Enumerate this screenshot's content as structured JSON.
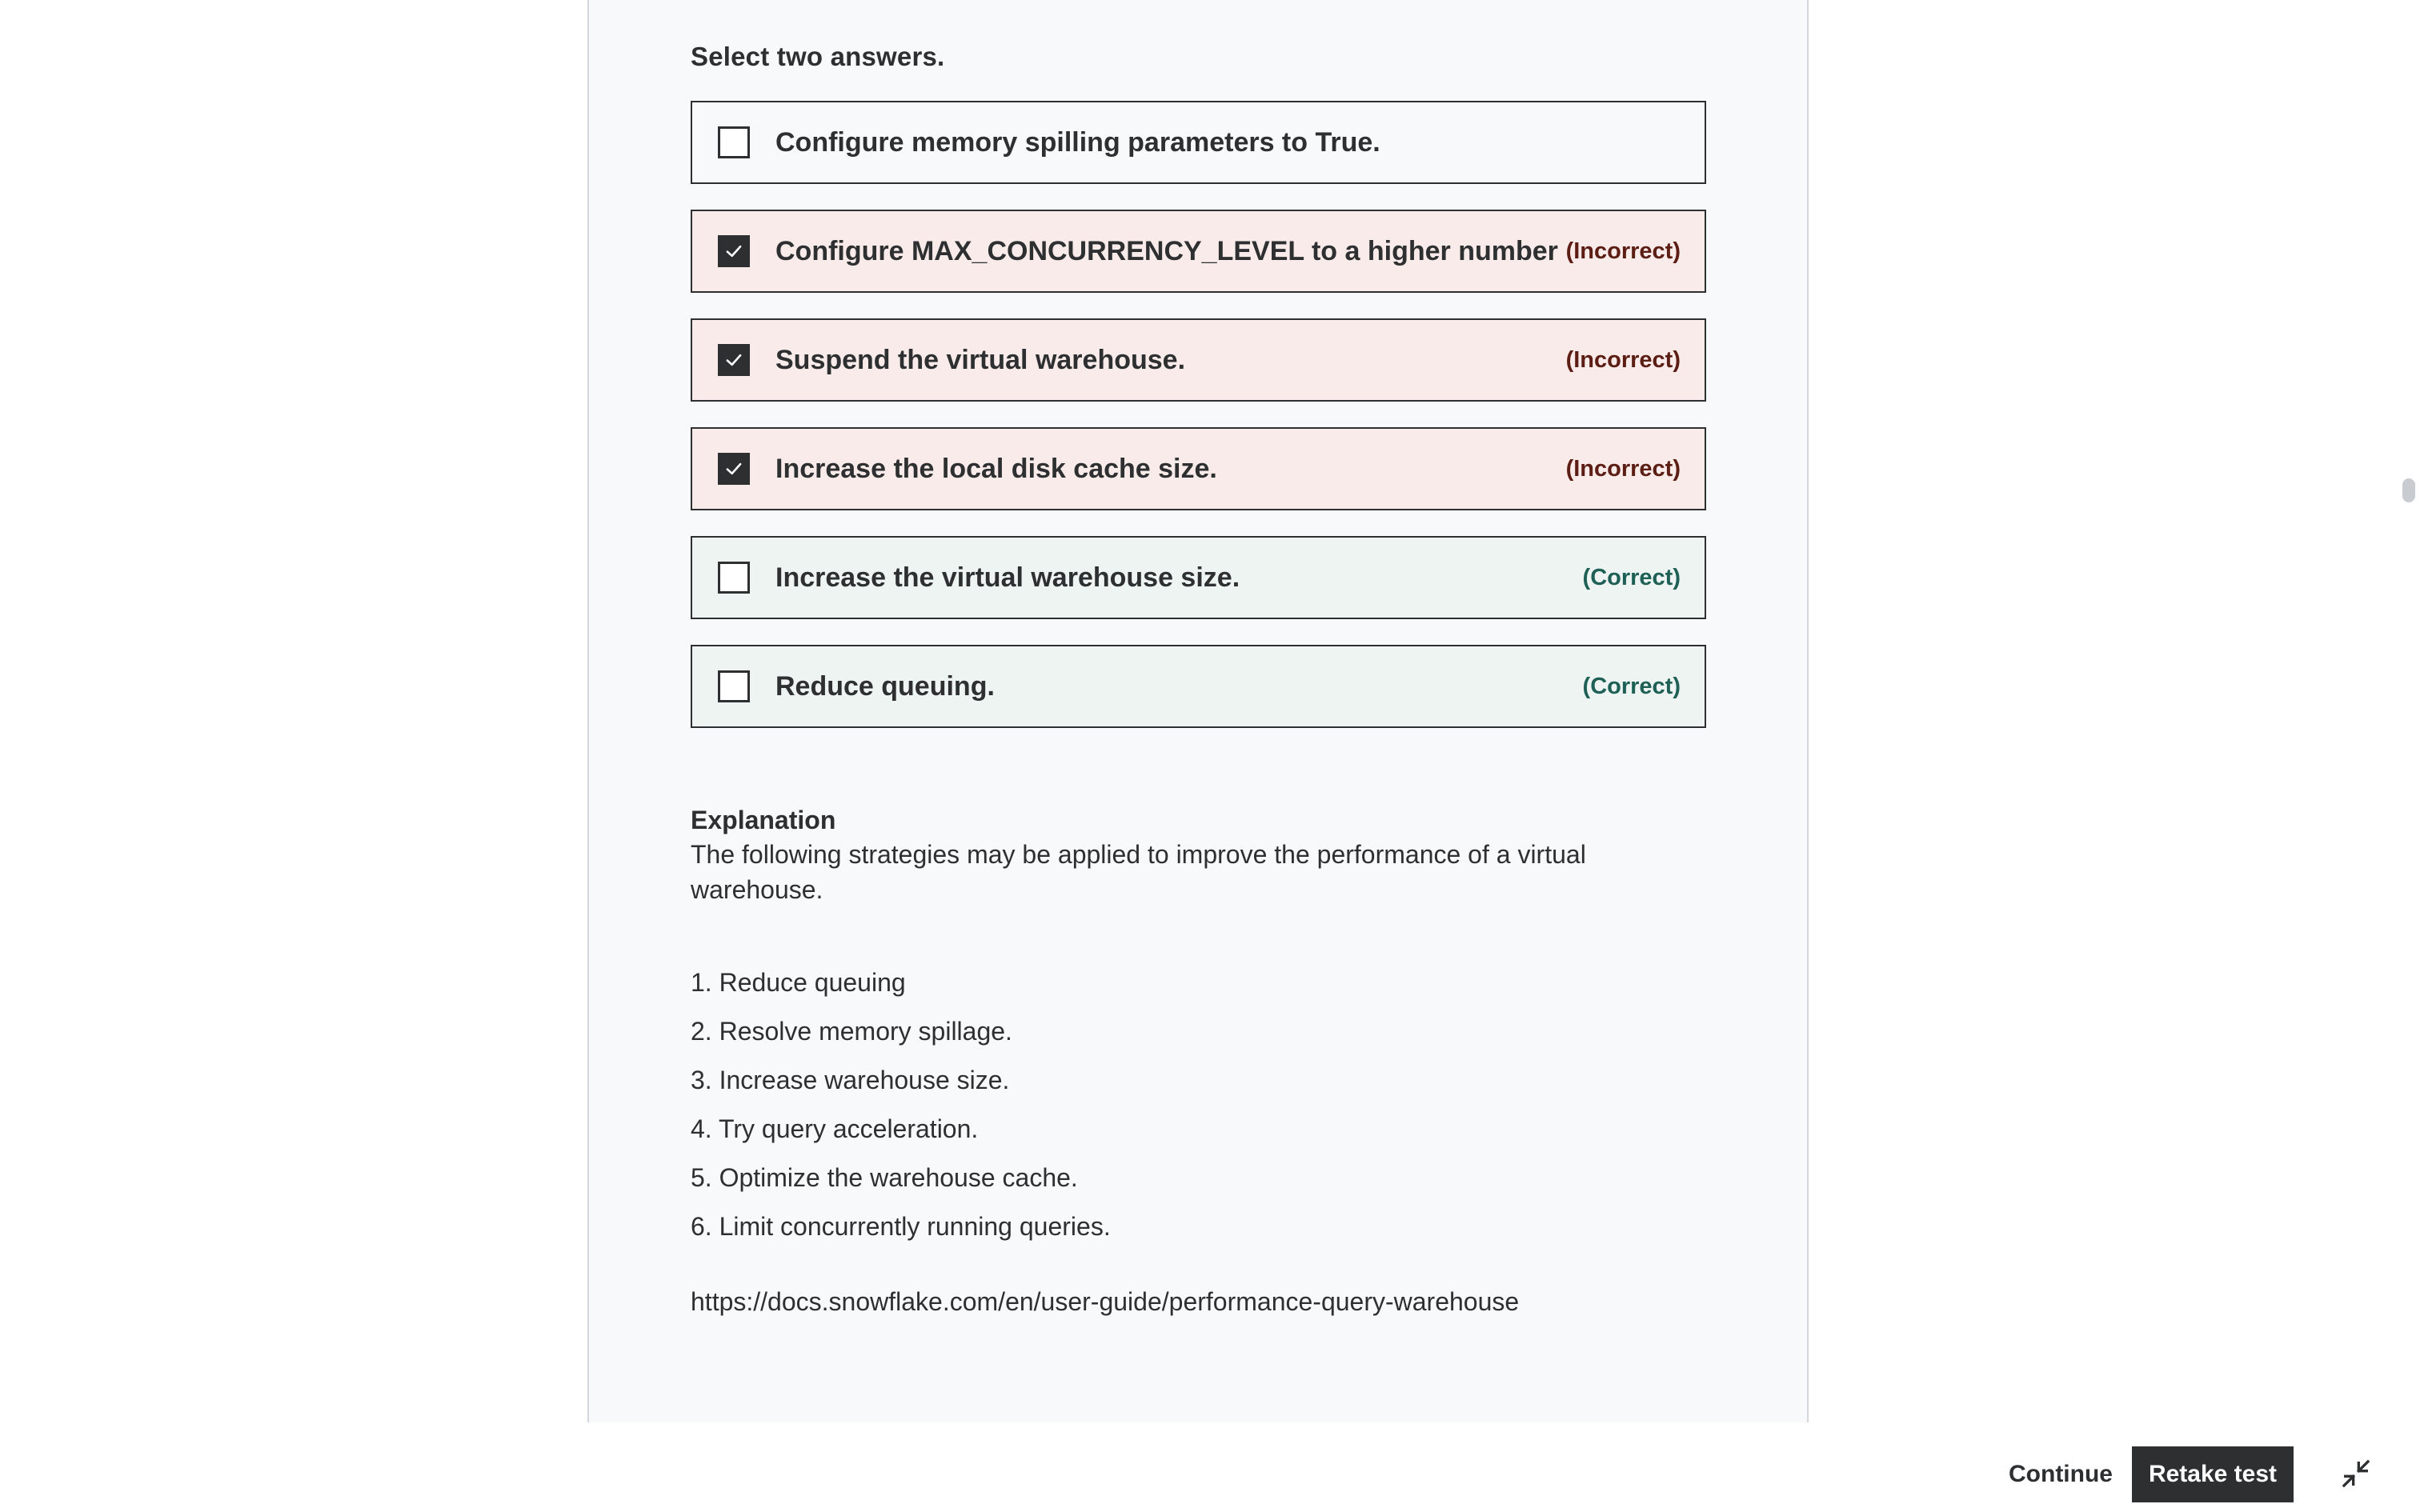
{
  "question": {
    "instruction": "Select two answers.",
    "answers": [
      {
        "text": "Configure memory spilling parameters to True.",
        "checked": false,
        "status": "neutral",
        "verdict": ""
      },
      {
        "text": "Configure MAX_CONCURRENCY_LEVEL to a higher number",
        "checked": true,
        "status": "incorrect",
        "verdict": "(Incorrect)"
      },
      {
        "text": "Suspend the virtual warehouse.",
        "checked": true,
        "status": "incorrect",
        "verdict": "(Incorrect)"
      },
      {
        "text": "Increase the local disk cache size.",
        "checked": true,
        "status": "incorrect",
        "verdict": "(Incorrect)"
      },
      {
        "text": "Increase the virtual warehouse size.",
        "checked": false,
        "status": "correct",
        "verdict": "(Correct)"
      },
      {
        "text": "Reduce queuing.",
        "checked": false,
        "status": "correct",
        "verdict": "(Correct)"
      }
    ]
  },
  "explanation": {
    "heading": "Explanation",
    "intro": "The following strategies may be applied to improve the performance of a virtual warehouse.",
    "items": [
      "1. Reduce queuing",
      "2. Resolve memory spillage.",
      "3. Increase warehouse size.",
      "4. Try query acceleration.",
      "5. Optimize the warehouse cache.",
      "6. Limit concurrently running queries."
    ],
    "link": "https://docs.snowflake.com/en/user-guide/performance-query-warehouse"
  },
  "footer": {
    "continue_label": "Continue",
    "retake_label": "Retake test",
    "minimize_icon": "minimize-icon"
  },
  "colors": {
    "incorrect_bg": "#f9ebe9",
    "correct_bg": "#eef4f2",
    "incorrect_text": "#5c1e14",
    "correct_text": "#1e6055",
    "dark": "#2d2f31"
  }
}
